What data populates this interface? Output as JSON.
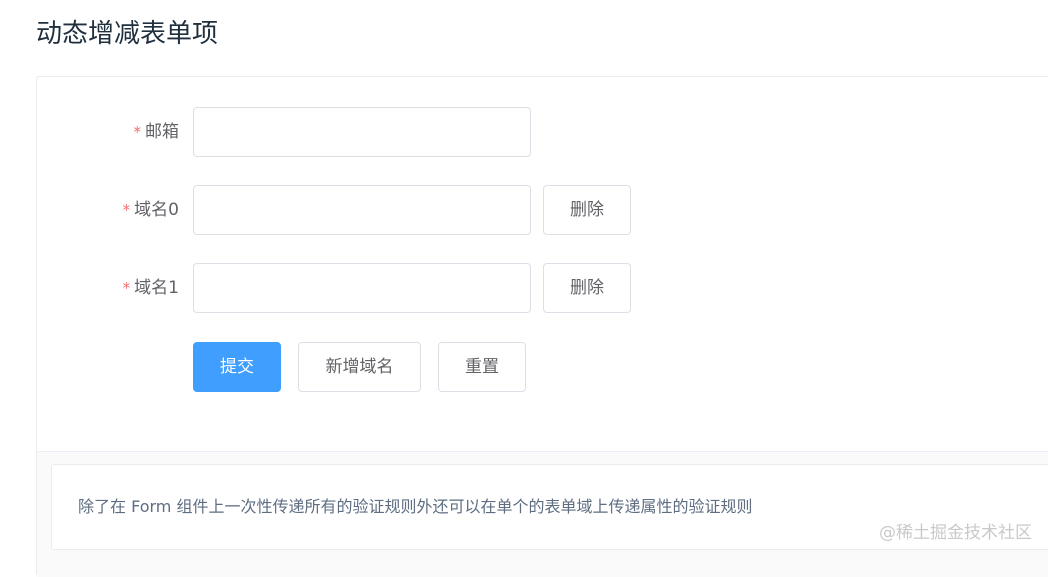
{
  "page": {
    "title": "动态增减表单项"
  },
  "form": {
    "rows": [
      {
        "label": "邮箱",
        "required": "*",
        "value": "",
        "has_delete": false
      },
      {
        "label": "域名0",
        "required": "*",
        "value": "",
        "has_delete": true
      },
      {
        "label": "域名1",
        "required": "*",
        "value": "",
        "has_delete": true
      }
    ],
    "delete_label": "删除",
    "actions": {
      "submit_label": "提交",
      "add_label": "新增域名",
      "reset_label": "重置"
    }
  },
  "description": {
    "text": "除了在 Form 组件上一次性传递所有的验证规则外还可以在单个的表单域上传递属性的验证规则"
  },
  "watermark": {
    "text": "@稀土掘金技术社区"
  },
  "colors": {
    "primary": "#409eff",
    "required": "#f56c6c",
    "border": "#dcdfe6",
    "text": "#606266",
    "title": "#1f2f3d"
  }
}
